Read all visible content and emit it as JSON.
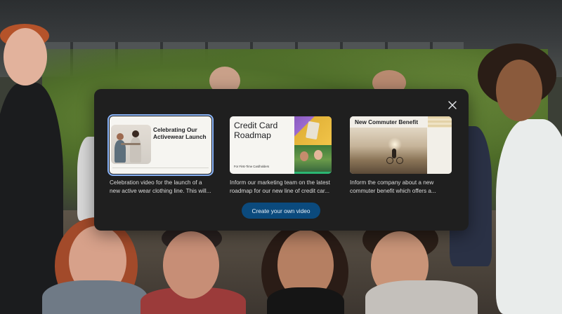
{
  "dialog": {
    "close_icon": "close-icon",
    "templates": [
      {
        "thumbnail_title": "Celebrating Our Activewear Launch",
        "description_line1": "Celebration video for the launch of a",
        "description_line2": "new active wear clothing line. This will...",
        "selected": true
      },
      {
        "thumbnail_title": "Credit Card Roadmap",
        "thumbnail_subtitle": "For First-Time Cardholders",
        "description_line1": "Inform our marketing team on the latest",
        "description_line2": "roadmap for our new line of credit car...",
        "selected": false
      },
      {
        "thumbnail_title": "New Commuter Benefit",
        "description_line1": "Inform the company about a new",
        "description_line2": "commuter benefit which offers a...",
        "selected": false
      }
    ],
    "cta_label": "Create your own video"
  },
  "colors": {
    "dialog_bg": "#1f1f1f",
    "cta_bg": "#0b4a7d",
    "selected_outline": "#8ab4f8"
  }
}
